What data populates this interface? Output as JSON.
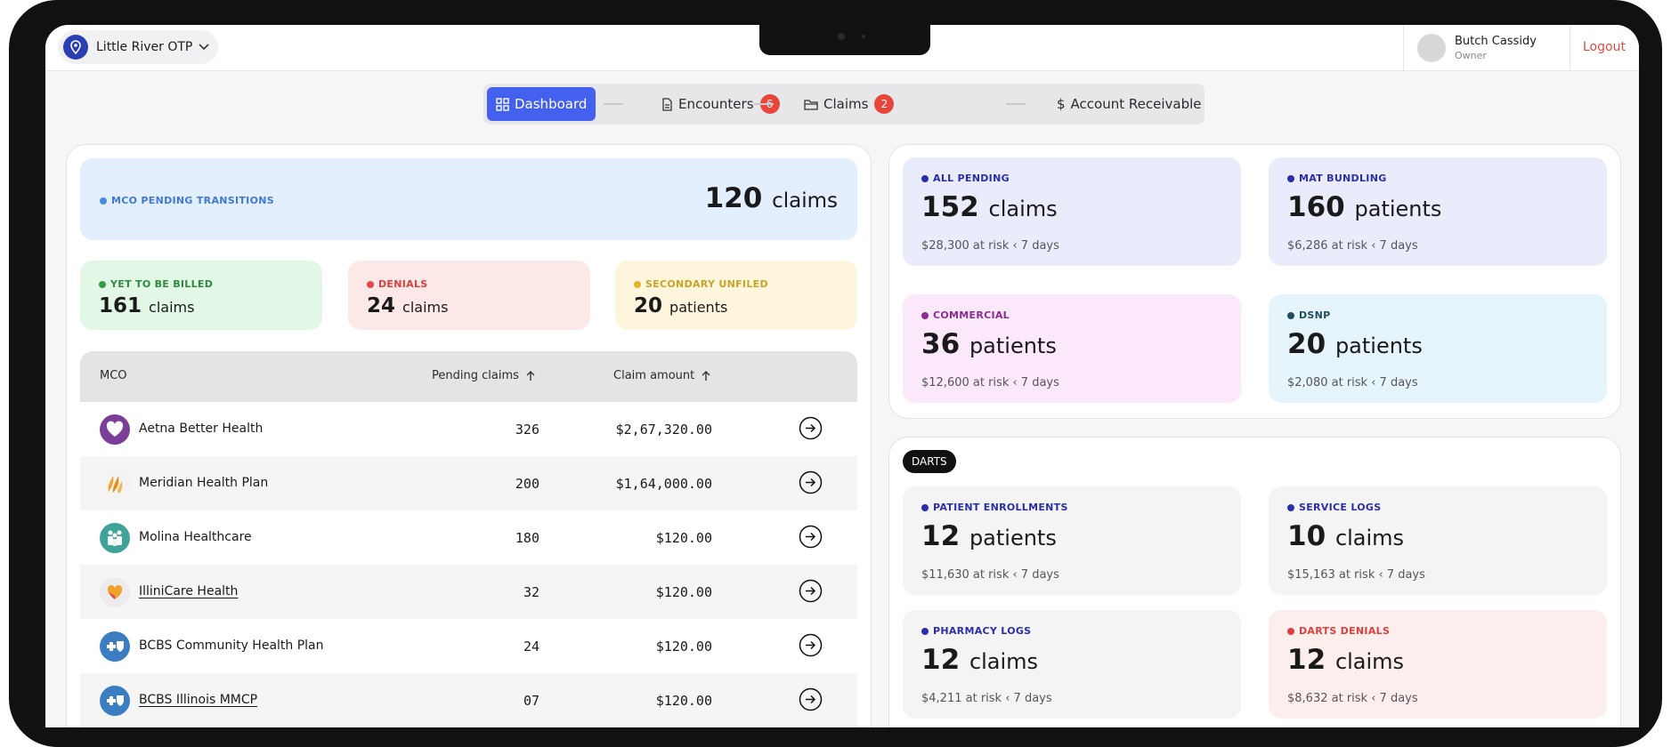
{
  "header": {
    "location": "Little River OTP",
    "user_name": "Butch Cassidy",
    "user_role": "Owner",
    "logout_label": "Logout"
  },
  "tabs": [
    {
      "label": "Dashboard",
      "badge": ""
    },
    {
      "label": "Encounters",
      "badge": "6"
    },
    {
      "label": "Claims",
      "badge": "2"
    },
    {
      "label": "Account Receivable",
      "badge": ""
    }
  ],
  "mco_pending": {
    "label": "MCO PENDING TRANSITIONS",
    "value": "120",
    "unit": "claims"
  },
  "summary": [
    {
      "label": "YET TO BE BILLED",
      "value": "161",
      "unit": "claims",
      "bg": "#e3f7e6",
      "dot": "#2f9e44",
      "color": "#2f8a3e"
    },
    {
      "label": "DENIALS",
      "value": "24",
      "unit": "claims",
      "bg": "#fde8e8",
      "dot": "#e5484d",
      "color": "#d9413f"
    },
    {
      "label": "SECONDARY UNFILED",
      "value": "20",
      "unit": "patients",
      "bg": "#fdf6dc",
      "dot": "#e0b52c",
      "color": "#c9a227"
    }
  ],
  "table": {
    "headers": {
      "mco": "MCO",
      "pending": "Pending claims",
      "amount": "Claim amount"
    },
    "rows": [
      {
        "name": "Aetna Better Health",
        "pending": "326",
        "amount": "$2,67,320.00",
        "logo": "heart-icon"
      },
      {
        "name": "Meridian Health Plan",
        "pending": "200",
        "amount": "$1,64,000.00",
        "logo": "flame-icon"
      },
      {
        "name": "Molina Healthcare",
        "pending": "180",
        "amount": "$120.00",
        "logo": "people-icon"
      },
      {
        "name": "IlliniCare Health",
        "pending": "32",
        "amount": "$120.00",
        "logo": "hands-heart-icon"
      },
      {
        "name": "BCBS Community Health Plan",
        "pending": "24",
        "amount": "$120.00",
        "logo": "cross-shield-icon"
      },
      {
        "name": "BCBS Illinois MMCP",
        "pending": "07",
        "amount": "$120.00",
        "logo": "cross-shield-icon"
      }
    ]
  },
  "top_cards": [
    {
      "label": "ALL PENDING",
      "value": "152",
      "unit": "claims",
      "risk": "$28,300 at risk ‹ 7 days",
      "bg": "#eaecfb",
      "dot": "#2a2fa8"
    },
    {
      "label": "MAT BUNDLING",
      "value": "160",
      "unit": "patients",
      "risk": "$6,286 at risk ‹ 7 days",
      "bg": "#eaecfb",
      "dot": "#2a2fa8"
    },
    {
      "label": "COMMERCIAL",
      "value": "36",
      "unit": "patients",
      "risk": "$12,600 at risk ‹ 7 days",
      "bg": "#fbe8fb",
      "dot": "#8a2d8f"
    },
    {
      "label": "DSNP",
      "value": "20",
      "unit": "patients",
      "risk": "$2,080 at risk ‹ 7 days",
      "bg": "#e6f4fb",
      "dot": "#1f4e5a"
    }
  ],
  "darts": {
    "tag": "DARTS",
    "cards": [
      {
        "label": "PATIENT ENROLLMENTS",
        "value": "12",
        "unit": "patients",
        "risk": "$11,630 at risk ‹ 7 days",
        "bg": "#f4f4f5",
        "dot": "#2a2fa8"
      },
      {
        "label": "SERVICE LOGS",
        "value": "10",
        "unit": "claims",
        "risk": "$15,163 at risk ‹ 7 days",
        "bg": "#f4f4f5",
        "dot": "#2a2fa8"
      },
      {
        "label": "PHARMACY LOGS",
        "value": "12",
        "unit": "claims",
        "risk": "$4,211 at risk ‹ 7 days",
        "bg": "#f4f4f5",
        "dot": "#2a2fa8"
      },
      {
        "label": "DARTS DENIALS",
        "value": "12",
        "unit": "claims",
        "risk": "$8,632 at risk ‹ 7 days",
        "bg": "#fdeeee",
        "dot": "#d9413f"
      }
    ]
  }
}
